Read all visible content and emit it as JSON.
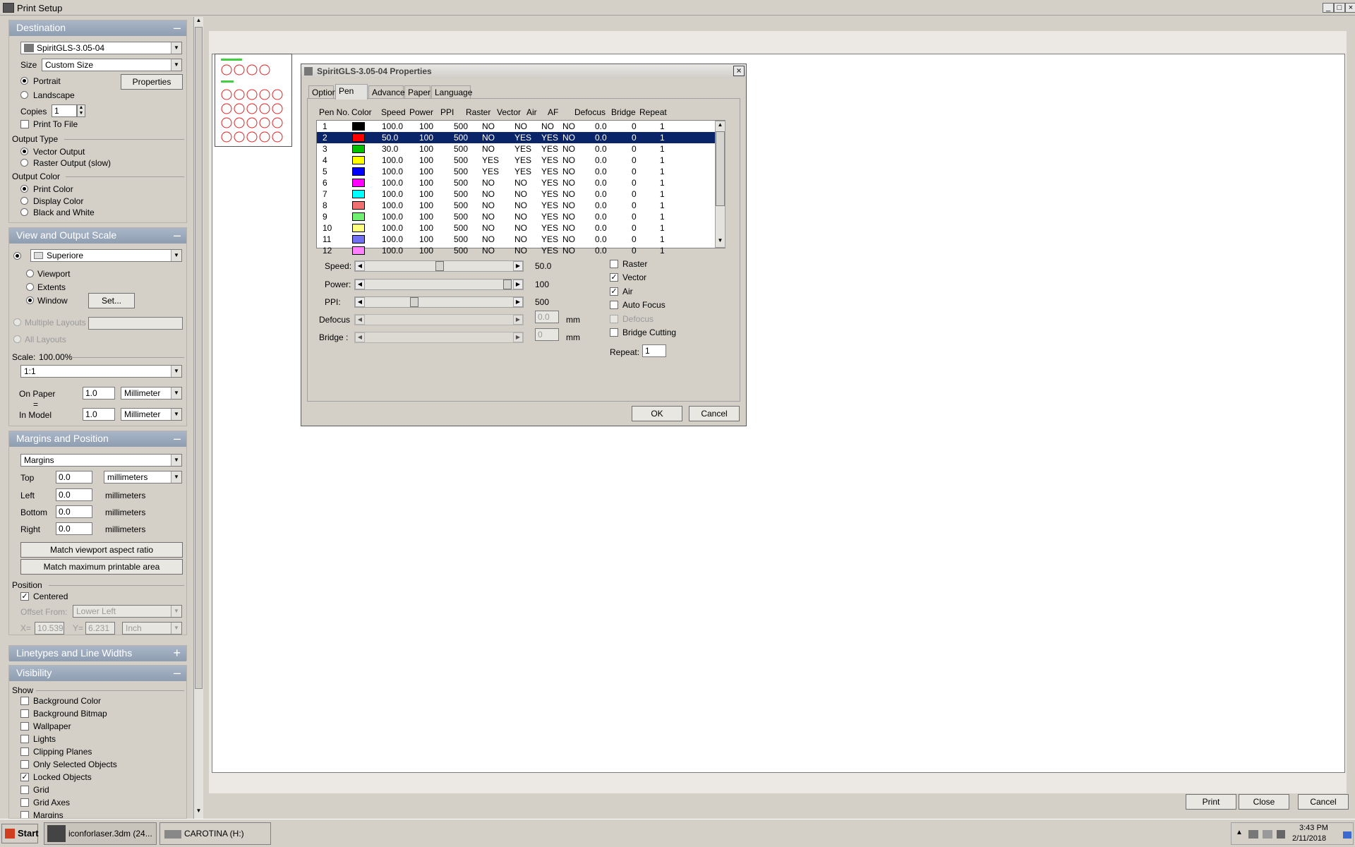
{
  "window": {
    "title": "Print Setup"
  },
  "destination": {
    "header": "Destination",
    "printer": "SpiritGLS-3.05-04",
    "size_label": "Size",
    "size": "Custom Size",
    "portrait": "Portrait",
    "landscape": "Landscape",
    "properties": "Properties",
    "copies_label": "Copies",
    "copies": "1",
    "print_to_file": "Print To File",
    "output_type_label": "Output Type",
    "vector_output": "Vector Output",
    "raster_output": "Raster Output (slow)",
    "output_color_label": "Output Color",
    "print_color": "Print Color",
    "display_color": "Display Color",
    "black_white": "Black and White"
  },
  "view": {
    "header": "View and Output Scale",
    "viewport_name": "Superiore",
    "viewport": "Viewport",
    "extents": "Extents",
    "window": "Window",
    "set": "Set...",
    "multiple_layouts": "Multiple Layouts",
    "all_layouts": "All Layouts",
    "scale_label": "Scale:",
    "scale_value": "100.00%",
    "scale": "1:1",
    "on_paper": "On Paper",
    "on_paper_value": "1.0",
    "on_paper_unit": "Millimeter",
    "equals": "=",
    "in_model": "In Model",
    "in_model_value": "1.0",
    "in_model_unit": "Millimeter"
  },
  "margins": {
    "header": "Margins and Position",
    "mode": "Margins",
    "top_label": "Top",
    "top": "0.0",
    "top_unit": "millimeters",
    "left_label": "Left",
    "left": "0.0",
    "left_unit": "millimeters",
    "bottom_label": "Bottom",
    "bottom": "0.0",
    "bottom_unit": "millimeters",
    "right_label": "Right",
    "right": "0.0",
    "right_unit": "millimeters",
    "match_viewport": "Match viewport aspect ratio",
    "match_max": "Match maximum printable area",
    "position_label": "Position",
    "centered": "Centered",
    "offset_from_label": "Offset From:",
    "offset_from": "Lower Left",
    "x_label": "X=",
    "x": "10.539",
    "y_label": "Y=",
    "y": "6.231",
    "unit": "Inch"
  },
  "linetypes": {
    "header": "Linetypes and Line Widths"
  },
  "visibility": {
    "header": "Visibility",
    "show_label": "Show",
    "items": [
      {
        "label": "Background Color",
        "checked": false
      },
      {
        "label": "Background Bitmap",
        "checked": false
      },
      {
        "label": "Wallpaper",
        "checked": false
      },
      {
        "label": "Lights",
        "checked": false
      },
      {
        "label": "Clipping Planes",
        "checked": false
      },
      {
        "label": "Only Selected Objects",
        "checked": false
      },
      {
        "label": "Locked Objects",
        "checked": true
      },
      {
        "label": "Grid",
        "checked": false
      },
      {
        "label": "Grid Axes",
        "checked": false
      },
      {
        "label": "Margins",
        "checked": false
      }
    ]
  },
  "dialog": {
    "title": "SpiritGLS-3.05-04 Properties",
    "tabs": [
      "Option",
      "Pen",
      "Advance",
      "Paper",
      "Language"
    ],
    "active_tab": "Pen",
    "headers": [
      "Pen No.",
      "Color",
      "Speed",
      "Power",
      "PPI",
      "Raster",
      "Vector",
      "Air",
      "AF",
      "Defocus",
      "Bridge",
      "Repeat"
    ],
    "rows": [
      {
        "no": "1",
        "color": "#000000",
        "speed": "100.0",
        "power": "100",
        "ppi": "500",
        "raster": "NO",
        "vector": "NO",
        "air": "NO",
        "af": "NO",
        "defocus": "0.0",
        "bridge": "0",
        "repeat": "1"
      },
      {
        "no": "2",
        "color": "#ff0000",
        "speed": "50.0",
        "power": "100",
        "ppi": "500",
        "raster": "NO",
        "vector": "YES",
        "air": "YES",
        "af": "NO",
        "defocus": "0.0",
        "bridge": "0",
        "repeat": "1"
      },
      {
        "no": "3",
        "color": "#00c000",
        "speed": "30.0",
        "power": "100",
        "ppi": "500",
        "raster": "NO",
        "vector": "YES",
        "air": "YES",
        "af": "NO",
        "defocus": "0.0",
        "bridge": "0",
        "repeat": "1"
      },
      {
        "no": "4",
        "color": "#ffff00",
        "speed": "100.0",
        "power": "100",
        "ppi": "500",
        "raster": "YES",
        "vector": "YES",
        "air": "YES",
        "af": "NO",
        "defocus": "0.0",
        "bridge": "0",
        "repeat": "1"
      },
      {
        "no": "5",
        "color": "#0000ff",
        "speed": "100.0",
        "power": "100",
        "ppi": "500",
        "raster": "YES",
        "vector": "YES",
        "air": "YES",
        "af": "NO",
        "defocus": "0.0",
        "bridge": "0",
        "repeat": "1"
      },
      {
        "no": "6",
        "color": "#ff00ff",
        "speed": "100.0",
        "power": "100",
        "ppi": "500",
        "raster": "NO",
        "vector": "NO",
        "air": "YES",
        "af": "NO",
        "defocus": "0.0",
        "bridge": "0",
        "repeat": "1"
      },
      {
        "no": "7",
        "color": "#00ffff",
        "speed": "100.0",
        "power": "100",
        "ppi": "500",
        "raster": "NO",
        "vector": "NO",
        "air": "YES",
        "af": "NO",
        "defocus": "0.0",
        "bridge": "0",
        "repeat": "1"
      },
      {
        "no": "8",
        "color": "#f07070",
        "speed": "100.0",
        "power": "100",
        "ppi": "500",
        "raster": "NO",
        "vector": "NO",
        "air": "YES",
        "af": "NO",
        "defocus": "0.0",
        "bridge": "0",
        "repeat": "1"
      },
      {
        "no": "9",
        "color": "#70f070",
        "speed": "100.0",
        "power": "100",
        "ppi": "500",
        "raster": "NO",
        "vector": "NO",
        "air": "YES",
        "af": "NO",
        "defocus": "0.0",
        "bridge": "0",
        "repeat": "1"
      },
      {
        "no": "10",
        "color": "#ffff80",
        "speed": "100.0",
        "power": "100",
        "ppi": "500",
        "raster": "NO",
        "vector": "NO",
        "air": "YES",
        "af": "NO",
        "defocus": "0.0",
        "bridge": "0",
        "repeat": "1"
      },
      {
        "no": "11",
        "color": "#7070f0",
        "speed": "100.0",
        "power": "100",
        "ppi": "500",
        "raster": "NO",
        "vector": "NO",
        "air": "YES",
        "af": "NO",
        "defocus": "0.0",
        "bridge": "0",
        "repeat": "1"
      },
      {
        "no": "12",
        "color": "#ff80ff",
        "speed": "100.0",
        "power": "100",
        "ppi": "500",
        "raster": "NO",
        "vector": "NO",
        "air": "YES",
        "af": "NO",
        "defocus": "0.0",
        "bridge": "0",
        "repeat": "1"
      }
    ],
    "selected_row": 1,
    "speed_label": "Speed:",
    "speed_value": "50.0",
    "power_label": "Power:",
    "power_value": "100",
    "ppi_label": "PPI:",
    "ppi_value": "500",
    "defocus_label": "Defocus",
    "defocus_value": "0.0",
    "bridge_label": "Bridge :",
    "bridge_value": "0",
    "mm": "mm",
    "raster": "Raster",
    "vector": "Vector",
    "air": "Air",
    "auto_focus": "Auto Focus",
    "defocus_chk": "Defocus",
    "bridge_cutting": "Bridge Cutting",
    "repeat_label": "Repeat:",
    "repeat_value": "1",
    "ok": "OK",
    "cancel": "Cancel",
    "vector_checked": true,
    "air_checked": true
  },
  "footer": {
    "print": "Print",
    "close": "Close",
    "cancel": "Cancel"
  },
  "taskbar": {
    "start": "Start",
    "items": [
      "iconforlaser.3dm (24...",
      "CAROTINA (H:)"
    ],
    "time": "3:43 PM",
    "date": "2/11/2018"
  },
  "colors": {
    "header_blue": "#0a246a",
    "panel_head": "#9aa7bb"
  }
}
